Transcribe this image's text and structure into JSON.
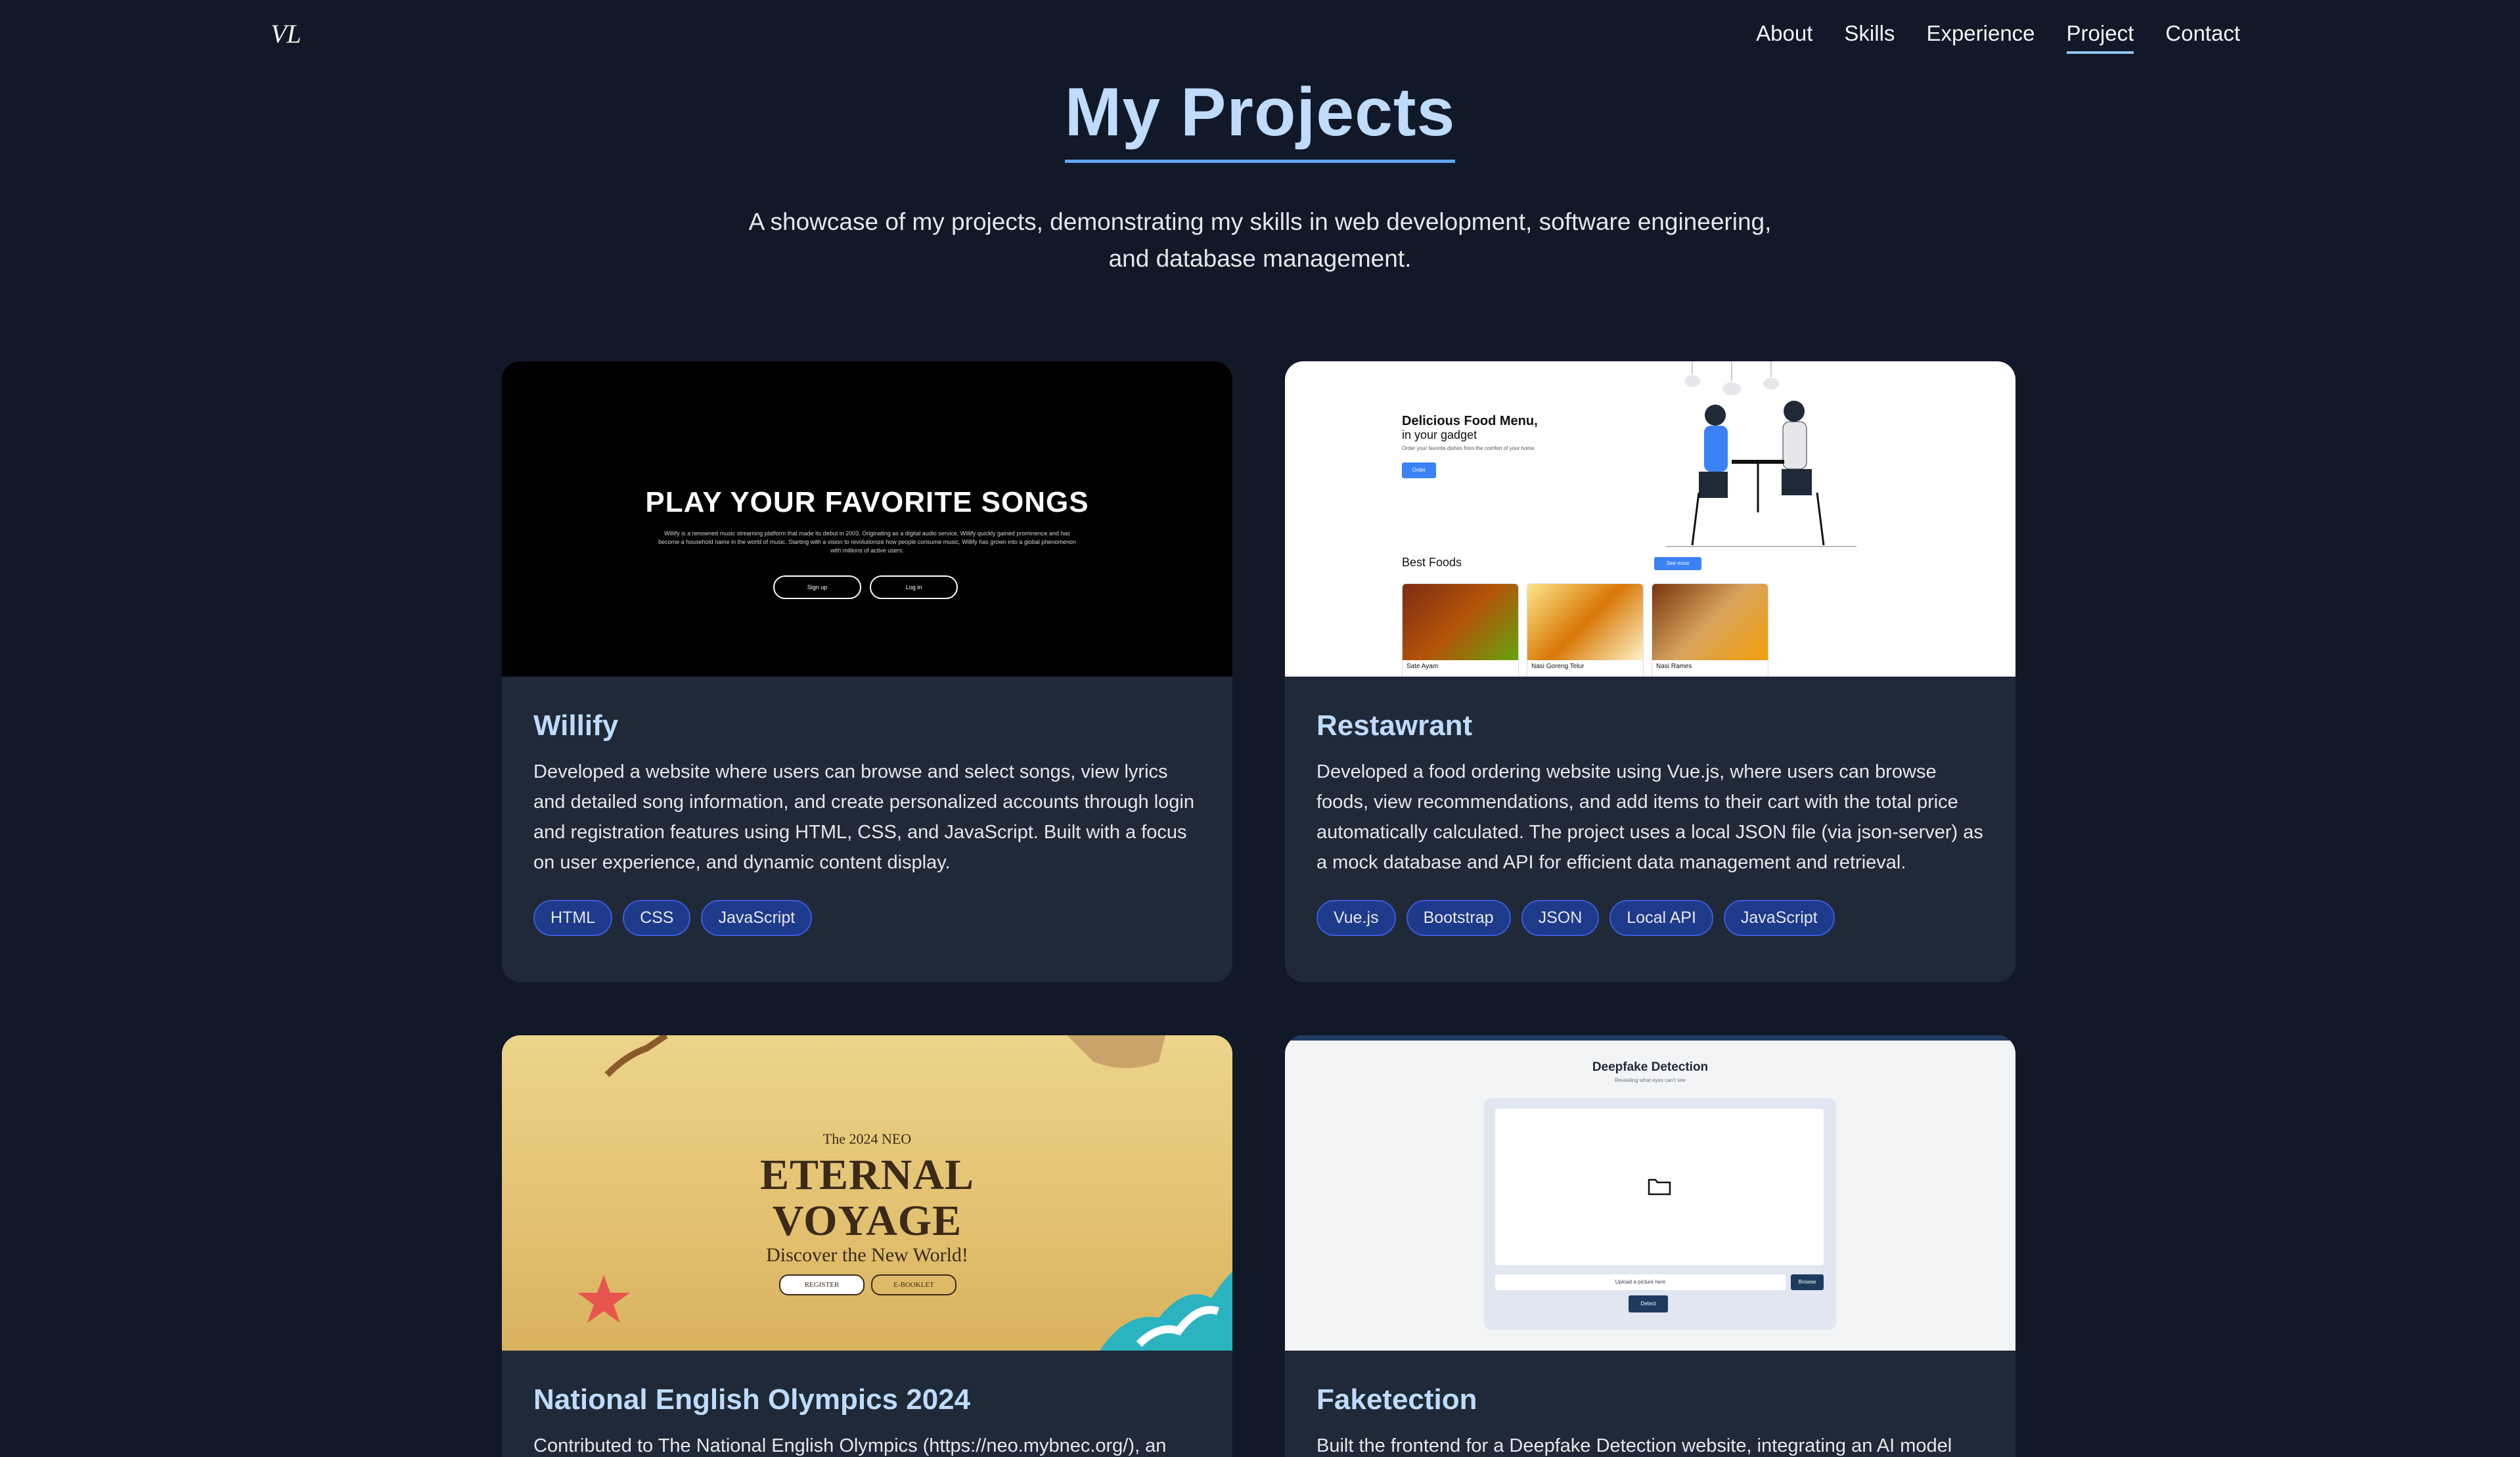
{
  "nav": {
    "logo": "VL",
    "links": [
      "About",
      "Skills",
      "Experience",
      "Project",
      "Contact"
    ],
    "active": "Project"
  },
  "header": {
    "title": "My Projects",
    "subtitle_line1": "A showcase of my projects, demonstrating my skills in web development, software engineering,",
    "subtitle_line2": "and database management."
  },
  "projects": [
    {
      "title": "Willify",
      "description": "Developed a website where users can browse and select songs, view lyrics and detailed song information, and create personalized accounts through login and registration features using HTML, CSS, and JavaScript. Built with a focus on user experience, and dynamic content display.",
      "tags": [
        "HTML",
        "CSS",
        "JavaScript"
      ],
      "preview": {
        "headline": "PLAY YOUR FAVORITE SONGS",
        "text": "Willify is a renowned music streaming platform that made its debut in 2003. Originating as a digital audio service, Willify quickly gained prominence and has become a household name in the world of music. Starting with a vision to revolutionize how people consume music, Willify has grown into a global phenomenon with millions of active users.",
        "btn_signup": "Sign up",
        "btn_login": "Log in"
      }
    },
    {
      "title": "Restawrant",
      "description": "Developed a food ordering website using Vue.js, where users can browse foods, view recommendations, and add items to their cart with the total price automatically calculated. The project uses a local JSON file (via json-server) as a mock database and API for efficient data management and retrieval.",
      "tags": [
        "Vue.js",
        "Bootstrap",
        "JSON",
        "Local API",
        "JavaScript"
      ],
      "preview": {
        "headline": "Delicious Food Menu,",
        "headline2": "in your gadget",
        "sub": "Order your favorite dishes from the comfort of your home.",
        "order": "Order",
        "best": "Best Foods",
        "see_more": "See more",
        "foods": [
          "Sate Ayam",
          "Nasi Goreng Telur",
          "Nasi Rames"
        ]
      }
    },
    {
      "title": "National English Olympics 2024",
      "description": "Contributed to The National English Olympics (https://neo.mybnec.org/), an",
      "tags": [],
      "preview": {
        "pre": "The 2024 NEO",
        "line1": "ETERNAL",
        "line2": "VOYAGE",
        "disc": "Discover the New World!",
        "register": "REGISTER",
        "ebooklet": "E-BOOKLET"
      }
    },
    {
      "title": "Faketection",
      "description": "Built the frontend for a Deepfake Detection website, integrating an AI model",
      "tags": [],
      "preview": {
        "headline": "Deepfake Detection",
        "sub": "Revealing what eyes can't see",
        "upload": "Upload a picture here",
        "browse": "Browse",
        "detect": "Detect"
      }
    }
  ]
}
